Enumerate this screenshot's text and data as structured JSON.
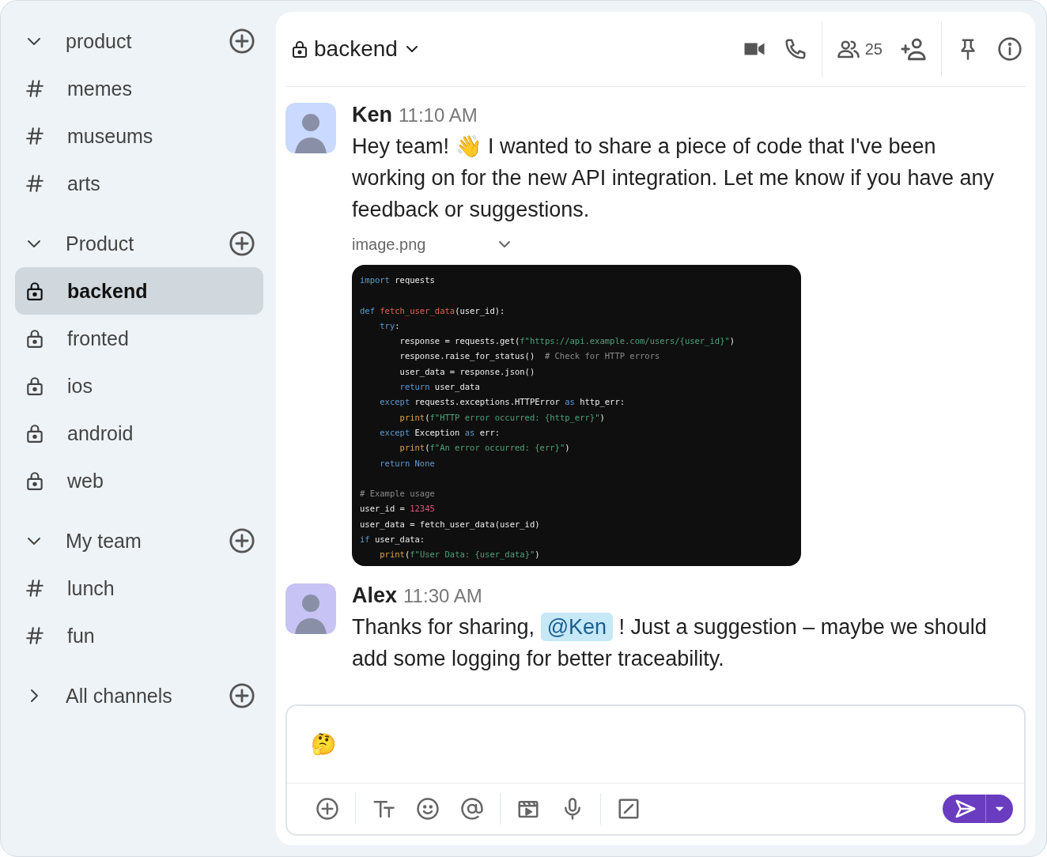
{
  "sidebar": {
    "sections": [
      {
        "title": "product",
        "expanded": true,
        "items": [
          {
            "label": "memes",
            "kind": "public",
            "selected": false
          },
          {
            "label": "museums",
            "kind": "public",
            "selected": false
          },
          {
            "label": "arts",
            "kind": "public",
            "selected": false
          }
        ]
      },
      {
        "title": "Product",
        "expanded": true,
        "items": [
          {
            "label": "backend",
            "kind": "private",
            "selected": true
          },
          {
            "label": "fronted",
            "kind": "private",
            "selected": false
          },
          {
            "label": "ios",
            "kind": "private",
            "selected": false
          },
          {
            "label": "android",
            "kind": "private",
            "selected": false
          },
          {
            "label": "web",
            "kind": "private",
            "selected": false
          }
        ]
      },
      {
        "title": "My team",
        "expanded": true,
        "items": [
          {
            "label": "lunch",
            "kind": "public",
            "selected": false
          },
          {
            "label": "fun",
            "kind": "public",
            "selected": false
          }
        ]
      },
      {
        "title": "All channels",
        "expanded": false
      }
    ]
  },
  "header": {
    "channel": "backend",
    "kind": "private",
    "member_count": "25"
  },
  "messages": [
    {
      "author": "Ken",
      "time": "11:10 AM",
      "parts": [
        {
          "kind": "text",
          "text": "Hey team! 👋 I wanted to share a piece of code that I've been working on for the new API integration. Let me know if you have any feedback or suggestions."
        }
      ],
      "attachment": {
        "filename": "image.png",
        "code_blocks": [
          [
            [
              {
                "kind": "keyword",
                "text": "import"
              },
              {
                "kind": "plain",
                "text": " requests"
              }
            ]
          ],
          [
            [
              {
                "kind": "keyword",
                "text": "def"
              },
              {
                "kind": "func",
                "text": " fetch_user_data"
              },
              {
                "kind": "plain",
                "text": "(user_id):"
              }
            ],
            [
              {
                "kind": "keyword",
                "text": "    try"
              },
              {
                "kind": "plain",
                "text": ":"
              }
            ],
            [
              {
                "kind": "plain",
                "text": "        response = requests.get("
              },
              {
                "kind": "string",
                "text": "f\"https://api.example.com/users/{user_id}\""
              },
              {
                "kind": "plain",
                "text": ")"
              }
            ],
            [
              {
                "kind": "plain",
                "text": "        response.raise_for_status()  "
              },
              {
                "kind": "comment",
                "text": "# Check for HTTP errors"
              }
            ],
            [
              {
                "kind": "plain",
                "text": "        user_data = response.json()"
              }
            ],
            [
              {
                "kind": "keyword",
                "text": "        return"
              },
              {
                "kind": "plain",
                "text": " user_data"
              }
            ],
            [
              {
                "kind": "keyword",
                "text": "    except"
              },
              {
                "kind": "plain",
                "text": " requests.exceptions.HTTPError "
              },
              {
                "kind": "keyword",
                "text": "as"
              },
              {
                "kind": "plain",
                "text": " http_err:"
              }
            ],
            [
              {
                "kind": "builtin",
                "text": "        print"
              },
              {
                "kind": "plain",
                "text": "("
              },
              {
                "kind": "string",
                "text": "f\"HTTP error occurred: {http_err}\""
              },
              {
                "kind": "plain",
                "text": ")"
              }
            ],
            [
              {
                "kind": "keyword",
                "text": "    except"
              },
              {
                "kind": "plain",
                "text": " Exception "
              },
              {
                "kind": "keyword",
                "text": "as"
              },
              {
                "kind": "plain",
                "text": " err:"
              }
            ],
            [
              {
                "kind": "builtin",
                "text": "        print"
              },
              {
                "kind": "plain",
                "text": "("
              },
              {
                "kind": "string",
                "text": "f\"An error occurred: {err}\""
              },
              {
                "kind": "plain",
                "text": ")"
              }
            ],
            [
              {
                "kind": "keyword",
                "text": "    return None"
              }
            ]
          ],
          [
            [
              {
                "kind": "comment",
                "text": "# Example usage"
              }
            ],
            [
              {
                "kind": "plain",
                "text": "user_id = "
              },
              {
                "kind": "number",
                "text": "12345"
              }
            ],
            [
              {
                "kind": "plain",
                "text": "user_data = fetch_user_data(user_id)"
              }
            ],
            [
              {
                "kind": "keyword",
                "text": "if"
              },
              {
                "kind": "plain",
                "text": " user_data:"
              }
            ],
            [
              {
                "kind": "builtin",
                "text": "    print"
              },
              {
                "kind": "plain",
                "text": "("
              },
              {
                "kind": "string",
                "text": "f\"User Data: {user_data}\""
              },
              {
                "kind": "plain",
                "text": ")"
              }
            ]
          ]
        ]
      }
    },
    {
      "author": "Alex",
      "time": "11:30 AM",
      "parts": [
        {
          "kind": "text",
          "text": "Thanks for sharing, "
        },
        {
          "kind": "mention",
          "text": "@Ken"
        },
        {
          "kind": "text",
          "text": " ! Just a suggestion – maybe we should add some logging for better traceability."
        }
      ]
    }
  ],
  "composer": {
    "value": "🤔"
  }
}
